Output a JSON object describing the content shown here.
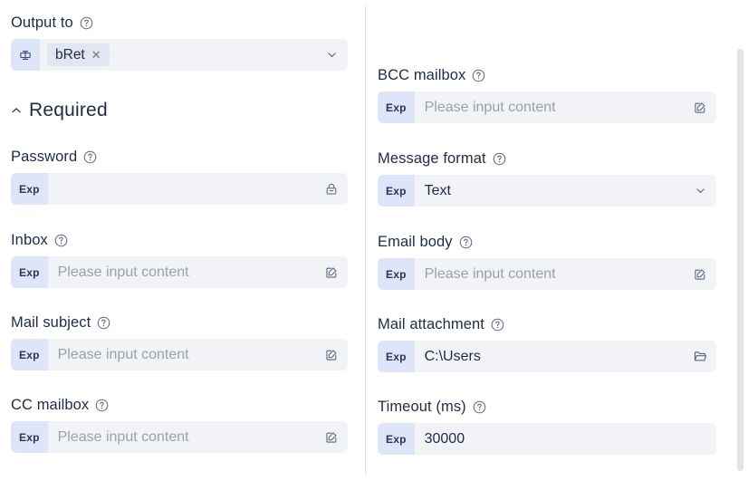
{
  "left_column": {
    "output_to": {
      "label": "Output to",
      "help_icon": "help-circle-icon",
      "variable_icon": "variable-text-cursor-icon",
      "tags": [
        {
          "text": "bRet",
          "close_icon": "close-icon"
        }
      ],
      "dropdown_icon": "chevron-down-icon"
    },
    "section": {
      "title": "Required",
      "caret_icon": "chevron-up-icon",
      "expanded": true
    },
    "fields": [
      {
        "label": "Password",
        "help_icon": "help-circle-icon",
        "badge": "Exp",
        "value": "",
        "placeholder": "",
        "suffix_icon": "lock-icon"
      },
      {
        "label": "Inbox",
        "help_icon": "help-circle-icon",
        "badge": "Exp",
        "value": "",
        "placeholder": "Please input content",
        "suffix_icon": "edit-pencil-icon"
      },
      {
        "label": "Mail subject",
        "help_icon": "help-circle-icon",
        "badge": "Exp",
        "value": "",
        "placeholder": "Please input content",
        "suffix_icon": "edit-pencil-icon"
      },
      {
        "label": "CC mailbox",
        "help_icon": "help-circle-icon",
        "badge": "Exp",
        "value": "",
        "placeholder": "Please input content",
        "suffix_icon": "edit-pencil-icon"
      }
    ]
  },
  "right_column": {
    "fields": [
      {
        "label": "BCC mailbox",
        "help_icon": "help-circle-icon",
        "badge": "Exp",
        "value": "",
        "placeholder": "Please input content",
        "suffix_icon": "edit-pencil-icon"
      },
      {
        "label": "Message format",
        "help_icon": "help-circle-icon",
        "badge": "Exp",
        "value": "Text",
        "placeholder": "",
        "suffix_icon": "chevron-down-icon"
      },
      {
        "label": "Email body",
        "help_icon": "help-circle-icon",
        "badge": "Exp",
        "value": "",
        "placeholder": "Please input content",
        "suffix_icon": "edit-pencil-icon"
      },
      {
        "label": "Mail attachment",
        "help_icon": "help-circle-icon",
        "badge": "Exp",
        "value": "C:\\Users",
        "placeholder": "",
        "suffix_icon": "folder-open-icon"
      },
      {
        "label": "Timeout (ms)",
        "help_icon": "help-circle-icon",
        "badge": "Exp",
        "value": "30000",
        "placeholder": "",
        "suffix_icon": ""
      }
    ]
  },
  "colors": {
    "panel_bg": "#ffffff",
    "control_bg": "#f1f3f7",
    "badge_bg": "#dfe5f8",
    "badge_text": "#2b3553",
    "label_text": "#1f2b45",
    "placeholder_text": "#9aa0ad",
    "icon_stroke": "#5b6580",
    "divider": "#dcdfe6",
    "scrollbar": "#e4e4e4"
  }
}
